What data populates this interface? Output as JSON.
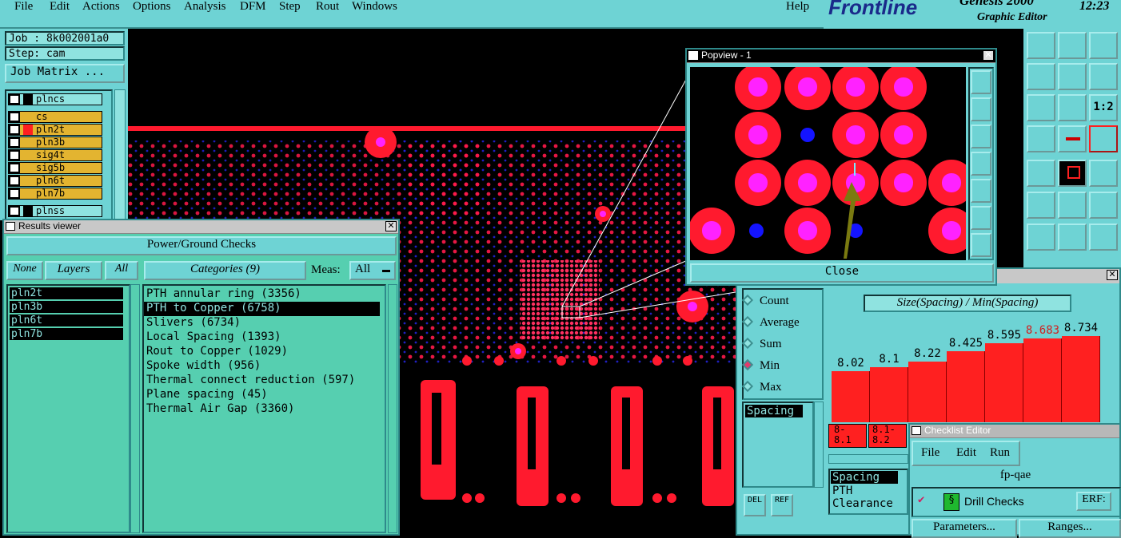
{
  "menubar": {
    "items": [
      "File",
      "Edit",
      "Actions",
      "Options",
      "Analysis",
      "DFM",
      "Step",
      "Rout",
      "Windows"
    ],
    "help": "Help"
  },
  "logo": {
    "brand": "Frontline",
    "product": "Genesis 2000",
    "subtitle": "Graphic Editor",
    "time": "12:23"
  },
  "job": {
    "job_label": "Job : 8k002001a0",
    "step_label": "Step: cam",
    "matrix_button": "Job Matrix ..."
  },
  "layers": [
    "plncs",
    "cs",
    "pln2t",
    "pln3b",
    "sig4t",
    "sig5b",
    "pln6t",
    "pln7b",
    "plnss"
  ],
  "results": {
    "title": "Results viewer",
    "header": "Power/Ground Checks",
    "none_button": "None",
    "layers_label": "Layers",
    "all_button": "All",
    "categories_label": "Categories (9)",
    "meas_label": "Meas:",
    "meas_value": "All",
    "layer_list": [
      "pln2t",
      "pln3b",
      "pln6t",
      "pln7b"
    ],
    "categories": [
      "PTH annular ring (3356)",
      "PTH to Copper (6758)",
      "Slivers (6734)",
      "Local Spacing (1393)",
      "Rout to Copper (1029)",
      "Spoke width (956)",
      "Thermal connect reduction (597)",
      "Plane spacing (45)",
      "Thermal Air Gap (3360)"
    ],
    "selected_category": 1
  },
  "popview": {
    "title": "Popview - 1",
    "close_button": "Close"
  },
  "histogram": {
    "modes": [
      "Count",
      "Average",
      "Sum",
      "Min",
      "Max"
    ],
    "selected_mode": "Min",
    "formula": "Size(Spacing) / Min(Spacing)",
    "bar_labels": [
      "8.02",
      "8.1",
      "8.22",
      "8.425",
      "8.595",
      "8.683",
      "8.734"
    ],
    "bar_values": [
      8.02,
      8.1,
      8.22,
      8.425,
      8.595,
      8.683,
      8.734
    ],
    "highlight_index": 5,
    "highlight_color": "#ff2020",
    "range_labels": [
      "8-",
      "8.1",
      "8.1-",
      "8.2"
    ],
    "left_list": [
      "Spacing"
    ],
    "right_list": [
      "Spacing",
      "PTH",
      "Clearance"
    ],
    "del_button": "DEL",
    "ref_button": "REF"
  },
  "checklist": {
    "title": "Checklist Editor",
    "menu": [
      "File",
      "Edit",
      "Run"
    ],
    "name": "fp-qae",
    "check_name": "Drill Checks",
    "erf_label": "ERF:",
    "parameters_button": "Parameters...",
    "ranges_button": "Ranges..."
  },
  "tools": [
    "move-up-icon",
    "move-down-icon",
    "home-icon",
    "move-left-icon",
    "move-right-icon",
    "refresh-icon",
    "zoom-fit-icon",
    "zoom-center-icon",
    "ratio-icon",
    "measure-icon",
    "cut-icon",
    "layers-icon",
    "snap-icon",
    "select-icon",
    "ruler-icon",
    "connect-icon",
    "cross-icon",
    "vector-icon",
    "angle-icon",
    "draw-icon",
    "undo-icon"
  ],
  "tool_text": {
    "ratio": "1:2"
  },
  "colors": {
    "panel": "#6ed3d4",
    "results_bg": "#56cfb0",
    "copper": "#ff1a2e",
    "drill": "#ff22ff",
    "via": "#1414ff",
    "layer_highlight": "#e3b430"
  }
}
